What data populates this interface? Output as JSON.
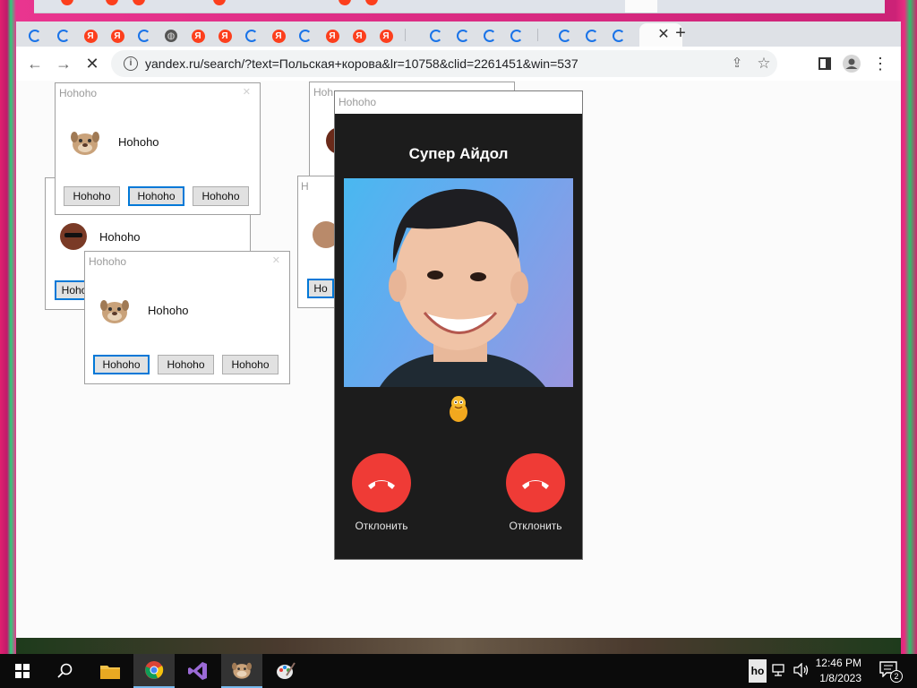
{
  "browser": {
    "url": "yandex.ru/search/?text=Польская+корова&lr=10758&clid=2261451&win=537",
    "tab_close": "✕",
    "new_tab": "+"
  },
  "dialogs": {
    "title": "Hohoho",
    "message": "Hohoho",
    "button": "Hohoho",
    "partial_button": "Hoho",
    "partial_button_2": "Ho",
    "partial_title": "Hoh"
  },
  "call": {
    "window_title": "Hohoho",
    "caller_name": "Супер Айдол",
    "decline_label_left": "Отклонить",
    "decline_label_right": "Отклонить"
  },
  "taskbar": {
    "time": "12:46 PM",
    "date": "1/8/2023",
    "tray_label": "ho",
    "notification_count": "2"
  },
  "colors": {
    "accent": "#0078d7",
    "decline": "#ef3b36",
    "yandex": "#fc3f1d",
    "chrome_tab": "#dee1e6"
  },
  "icons": [
    "back-icon",
    "forward-icon",
    "stop-icon",
    "info-icon",
    "share-icon",
    "star-icon",
    "sidepanel-icon",
    "profile-icon",
    "menu-icon",
    "windows-icon",
    "search-icon",
    "folder-icon",
    "chrome-icon",
    "visual-studio-icon",
    "talking-dog-icon",
    "paint-icon",
    "network-icon",
    "volume-icon",
    "notification-icon"
  ]
}
